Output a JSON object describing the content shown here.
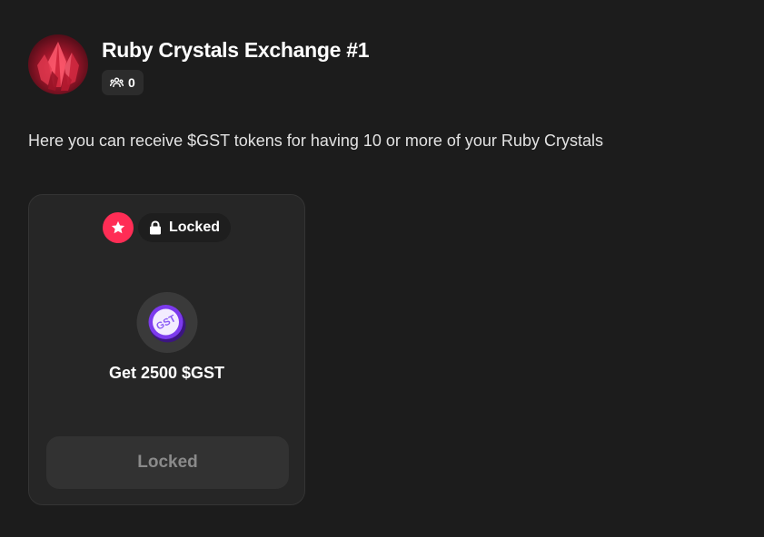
{
  "header": {
    "title": "Ruby Crystals Exchange #1",
    "members_count": "0",
    "members_icon": "users-icon",
    "avatar_icon": "ruby-crystal-avatar"
  },
  "description": "Here you can receive $GST tokens for having 10 or more of your Ruby Crystals",
  "reward_card": {
    "badge_icon": "star-icon",
    "status_icon": "lock-icon",
    "status_label": "Locked",
    "token_icon": "gst-token-icon",
    "token_symbol": "GST",
    "reward_label": "Get 2500 $GST",
    "button_label": "Locked"
  },
  "colors": {
    "background": "#1c1c1c",
    "card": "#262626",
    "accent": "#ff2d55",
    "token": "#7c3aed"
  }
}
